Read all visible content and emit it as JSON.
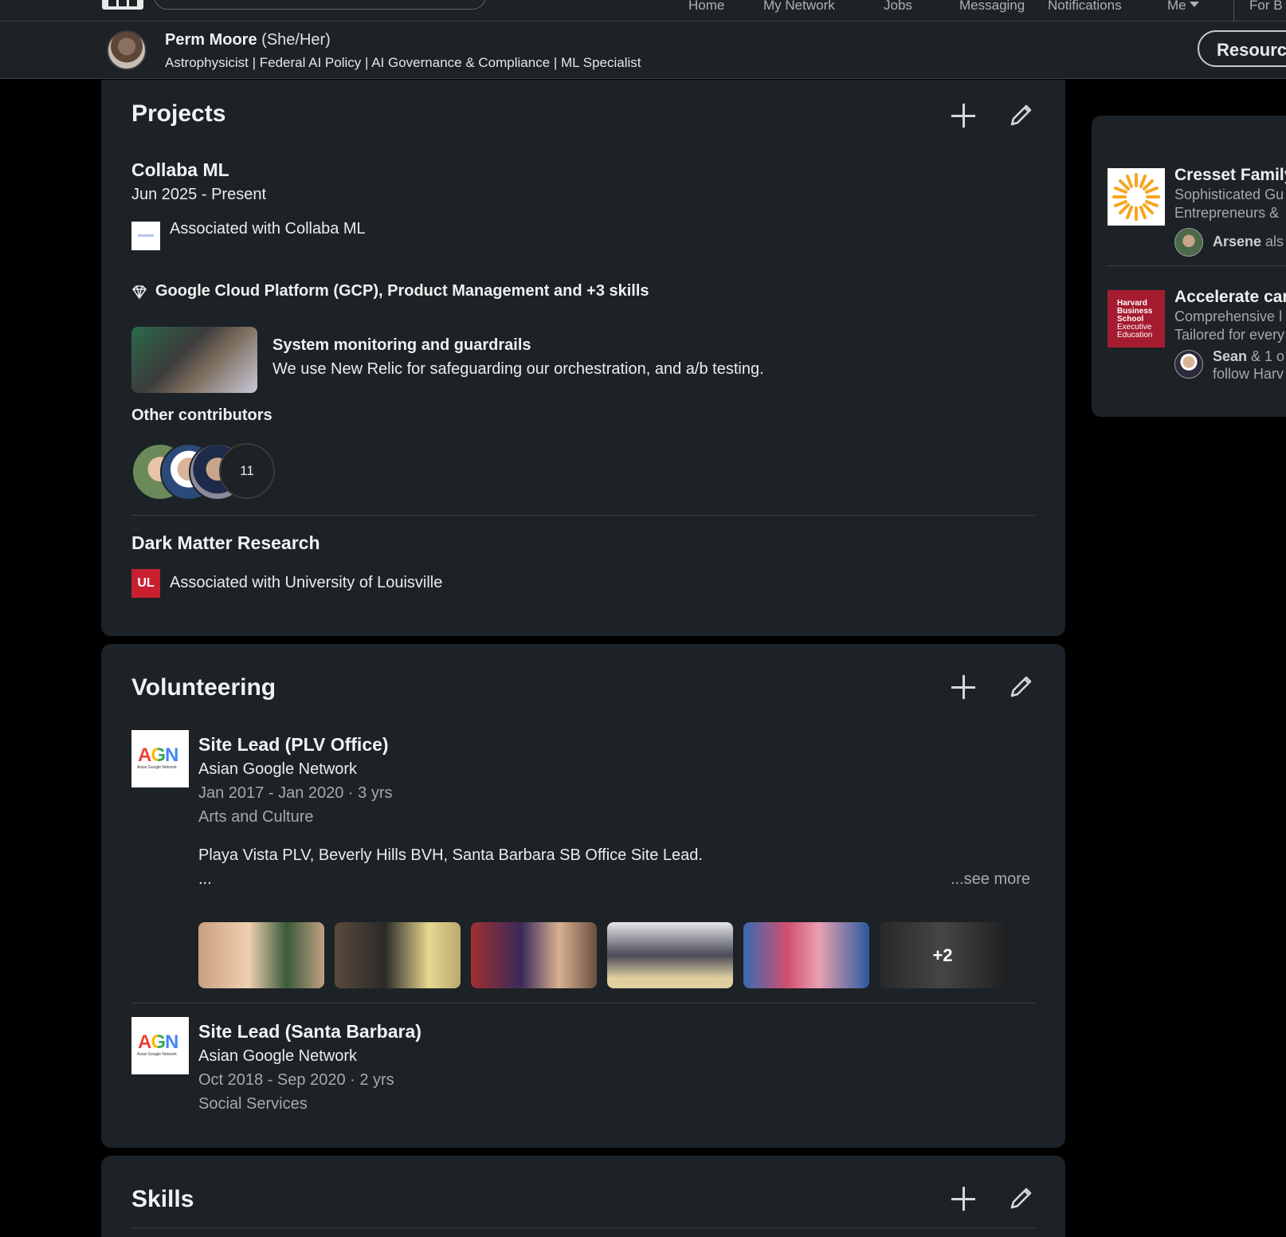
{
  "nav": {
    "items": [
      "Home",
      "My Network",
      "Jobs",
      "Messaging",
      "Notifications",
      "Me",
      "For B"
    ]
  },
  "header": {
    "name": "Perm Moore",
    "pronouns": "(She/Her)",
    "headline": "Astrophysicist | Federal AI Policy | AI Governance & Compliance | ML Specialist",
    "resources_label": "Resourc"
  },
  "projects": {
    "title": "Projects",
    "items": [
      {
        "name": "Collaba ML",
        "dates": "Jun 2025 - Present",
        "association": "Associated with Collaba ML",
        "skills": "Google Cloud Platform (GCP), Product Management and +3 skills",
        "media_title": "System monitoring and guardrails",
        "media_desc": "We use New Relic for safeguarding our orchestration, and a/b testing.",
        "contributors_label": "Other contributors",
        "contributors_count": "11"
      },
      {
        "name": "Dark Matter Research",
        "association": "Associated with University of Louisville",
        "logo_text": "UL"
      }
    ]
  },
  "volunteering": {
    "title": "Volunteering",
    "items": [
      {
        "role": "Site Lead (PLV Office)",
        "org": "Asian Google Network",
        "dates": "Jan 2017 - Jan 2020 · 3 yrs",
        "cause": "Arts and Culture",
        "description": "Playa Vista PLV, Beverly Hills BVH, Santa Barbara SB Office Site Lead.",
        "ellipsis": "...",
        "see_more": "...see more",
        "more_photos": "+2"
      },
      {
        "role": "Site Lead (Santa Barbara)",
        "org": "Asian Google Network",
        "dates": "Oct 2018 - Sep 2020 · 2 yrs",
        "cause": "Social Services"
      }
    ],
    "logo_text": "AGN",
    "logo_sub": "Asian Google Network"
  },
  "skills": {
    "title": "Skills"
  },
  "rail": {
    "items": [
      {
        "title": "Cresset Family",
        "line1": "Sophisticated Gu",
        "line2": "Entrepreneurs &",
        "social_name": "Arsene",
        "social_rest": " als"
      },
      {
        "title": "Accelerate car",
        "line1": "Comprehensive l",
        "line2": "Tailored for every",
        "social_name": "Sean",
        "social_rest": " & 1 o",
        "social_line2": "follow Harv",
        "logo_lines": [
          "Harvard",
          "Business",
          "School",
          "Executive",
          "Education"
        ]
      }
    ]
  },
  "colors": {
    "background": "#000000",
    "card": "#1d2226",
    "text_primary": "#e9e9e9",
    "text_muted": "#a8a8a8",
    "ul_red": "#c8202f",
    "hbs_crimson": "#a51c30",
    "cresset_orange": "#f5a623"
  },
  "icons": [
    "plus-icon",
    "pencil-icon",
    "skill-gem-icon",
    "me-caret-icon"
  ]
}
